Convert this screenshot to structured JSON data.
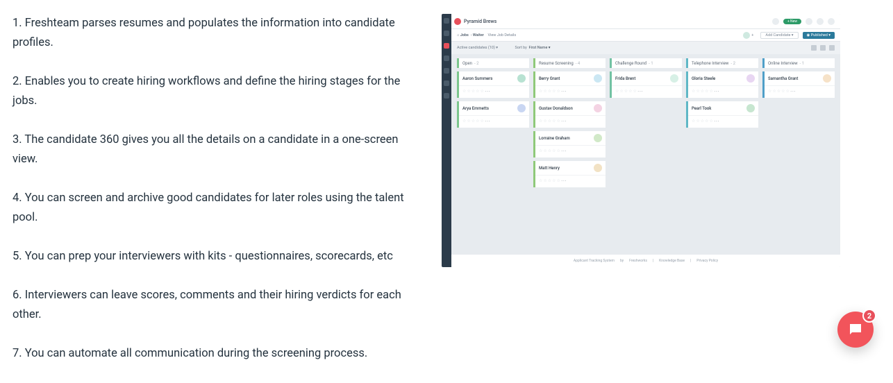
{
  "features": [
    "1. Freshteam parses resumes and populates the information into candidate profiles.",
    "2. Enables you to create hiring workflows and define the hiring stages for the jobs.",
    "3. The candidate 360 gives you all the details on a candidate in a one-screen view.",
    "4. You can screen and archive good candidates for later roles using the talent pool.",
    "5. You can prep your interviewers with kits - questionnaires, scorecards, etc",
    "6. Interviewers can leave scores, comments and their hiring verdicts for each other.",
    "7. You can automate all communication during the screening process."
  ],
  "app": {
    "brand": "Pyramid Brews",
    "new_button": "+ New",
    "breadcrumb": {
      "home_icon": "⌂",
      "jobs": "Jobs",
      "sep": "›",
      "role": "Waiter",
      "view": "View Job Details"
    },
    "add_candidate": "Add Candidate  ▾",
    "published": "◉ Published  ▾",
    "filter": {
      "active_label": "Active candidates (10)  ▾",
      "sort_label": "Sort by",
      "sort_value": "First Name ▾"
    },
    "columns": [
      {
        "title": "Open",
        "count": "2",
        "cls": "c-open",
        "cards": [
          {
            "name": "Aaron Summers",
            "av": "av1"
          },
          {
            "name": "Arya Emmetts",
            "av": "av2"
          }
        ]
      },
      {
        "title": "Resume Screening",
        "count": "4",
        "cls": "c-resume",
        "cards": [
          {
            "name": "Berry Grant",
            "av": "av3"
          },
          {
            "name": "Gustav Donaldson",
            "av": "av4"
          },
          {
            "name": "Lorraine Graham",
            "av": "av5"
          },
          {
            "name": "Matt Henry",
            "av": "av6"
          }
        ]
      },
      {
        "title": "Challenge Round",
        "count": "1",
        "cls": "c-chal",
        "cards": [
          {
            "name": "Frida Brent",
            "av": "av7"
          }
        ]
      },
      {
        "title": "Telephone Interview",
        "count": "2",
        "cls": "c-tel",
        "cards": [
          {
            "name": "Gloria Steele",
            "av": "av8"
          },
          {
            "name": "Pearl Took",
            "av": "av9"
          }
        ]
      },
      {
        "title": "Online Interview",
        "count": "1",
        "cls": "c-online",
        "cards": [
          {
            "name": "Samantha Grant",
            "av": "av10"
          }
        ]
      }
    ],
    "footer": {
      "a": "Applicant Tracking System",
      "by": "by",
      "b": "Freshworks",
      "c": "Knowledge Base",
      "d": "Privacy Policy"
    }
  },
  "chat_badge": "2"
}
